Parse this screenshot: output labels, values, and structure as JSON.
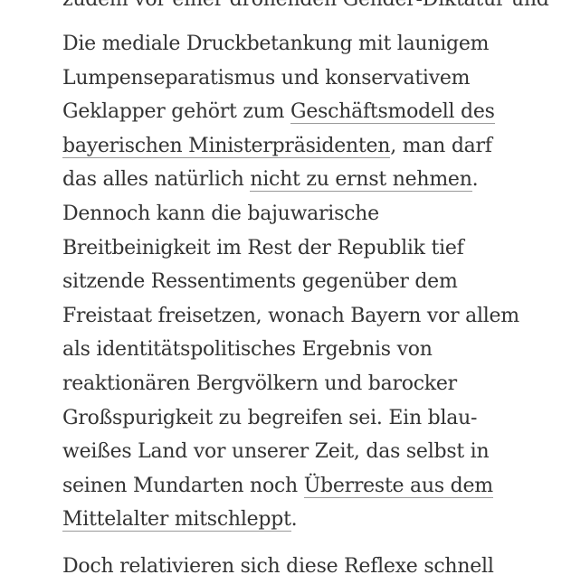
{
  "article": {
    "para_top_partial": {
      "line1": "zudem vor einer drohenden Gender-Diktatur und"
    },
    "para_main": {
      "l1": "Die mediale Druckbetankung mit launigem",
      "l2": "Lumpenseparatismus und konservativem",
      "l3_pre": "Geklapper gehört zum ",
      "link1_part1": "Geschäftsmodell des",
      "link1_part2": "bayerischen Ministerpräsidenten",
      "l4_post": ", man darf",
      "l5_pre": "das alles natürlich ",
      "link2": "nicht zu ernst nehmen",
      "l5_post": ".",
      "l6": "Dennoch kann die bajuwarische",
      "l7": "Breitbeinigkeit im Rest der Republik tief",
      "l8": "sitzende Ressentiments gegenüber dem",
      "l9": "Freistaat freisetzen, wonach Bayern vor allem",
      "l10": "als identitätspolitisches Ergebnis von",
      "l11": "reaktionären Bergvölkern und barocker",
      "l12": "Großspurigkeit zu begreifen sei. Ein blau-",
      "l13": "weißes Land vor unserer Zeit, das selbst in",
      "l14_pre": "seinen Mundarten noch ",
      "link3_part1": "Überreste aus dem",
      "link3_part2": "Mittelalter mitschleppt",
      "l15_post": "."
    },
    "para_bottom_partial": {
      "line1": "Doch relativieren sich diese Reflexe schnell"
    }
  }
}
